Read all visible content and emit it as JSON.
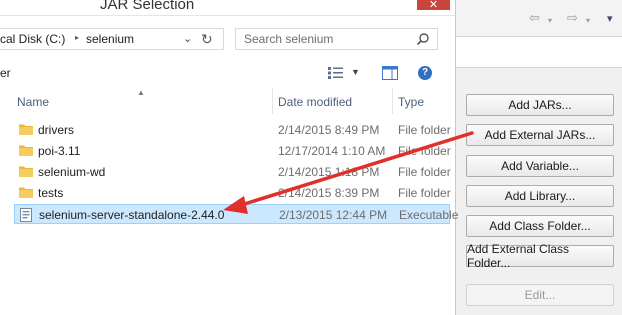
{
  "dialog": {
    "title": "JAR Selection",
    "close_glyph": "✕",
    "address": {
      "segments": [
        "cal Disk (C:)",
        "selenium"
      ],
      "separator_glyph": "▸",
      "dropdown_glyph": "⌄",
      "refresh_glyph": "↻"
    },
    "search": {
      "placeholder": "Search selenium"
    },
    "command_bar": {
      "label": "er"
    },
    "columns": {
      "name": "Name",
      "date_modified": "Date modified",
      "type": "Type"
    },
    "files": [
      {
        "name": "drivers",
        "date": "2/14/2015 8:49 PM",
        "type": "File folder",
        "kind": "folder"
      },
      {
        "name": "poi-3.11",
        "date": "12/17/2014 1:10 AM",
        "type": "File folder",
        "kind": "folder"
      },
      {
        "name": "selenium-wd",
        "date": "2/14/2015 1:18 PM",
        "type": "File folder",
        "kind": "folder"
      },
      {
        "name": "tests",
        "date": "2/14/2015 8:39 PM",
        "type": "File folder",
        "kind": "folder"
      },
      {
        "name": "selenium-server-standalone-2.44.0",
        "date": "2/13/2015 12:44 PM",
        "type": "Executable",
        "kind": "jar",
        "selected": true
      }
    ]
  },
  "eclipse_panel": {
    "nav": {
      "back_glyph": "⇦",
      "forward_glyph": "⇨",
      "dropdown_glyph": "▾"
    },
    "buttons": [
      {
        "label": "Add JARs...",
        "enabled": true
      },
      {
        "label": "Add External JARs...",
        "enabled": true
      },
      {
        "label": "Add Variable...",
        "enabled": true
      },
      {
        "label": "Add Library...",
        "enabled": true
      },
      {
        "label": "Add Class Folder...",
        "enabled": true
      },
      {
        "label": "Add External Class Folder...",
        "enabled": true
      },
      {
        "label": "Edit...",
        "enabled": false
      }
    ]
  },
  "annotation": {
    "arrow_color": "#e0302a"
  },
  "colors": {
    "selection_fill": "#cce8ff",
    "selection_border": "#99d1ff",
    "folder": "#e8b838",
    "close_button": "#c7463c"
  }
}
